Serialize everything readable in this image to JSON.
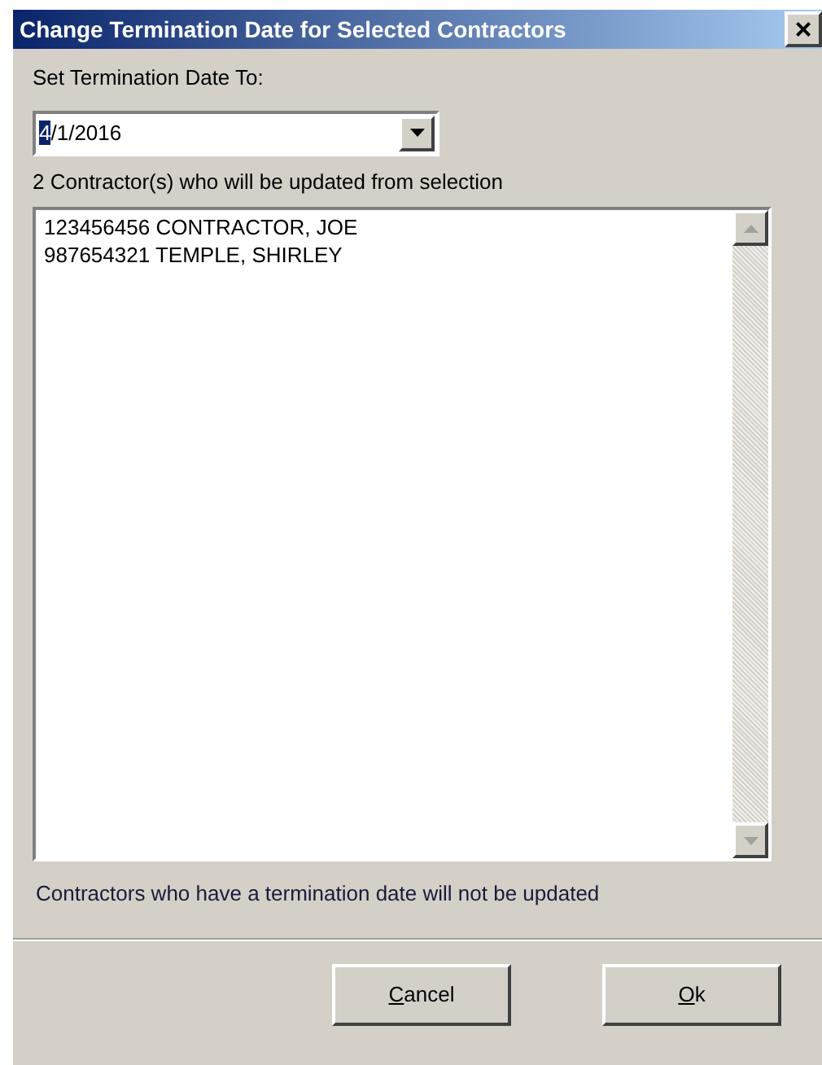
{
  "window": {
    "title": "Change Termination Date for Selected Contractors",
    "close": "×"
  },
  "date_label": "Set Termination Date To:",
  "date_field": {
    "value": "4/1/2016",
    "first_char_selected": true
  },
  "list_label": "2 Contractor(s) who will be updated from selection",
  "contractors": [
    {
      "id": "123456456",
      "name": "CONTRACTOR, JOE"
    },
    {
      "id": "987654321",
      "name": "TEMPLE, SHIRLEY"
    }
  ],
  "note": "Contractors who have a termination date will not be updated",
  "buttons": [
    {
      "label": "Cancel",
      "mnemonic_underlined": true
    },
    {
      "label": "Ok",
      "mnemonic_underlined": true
    }
  ]
}
